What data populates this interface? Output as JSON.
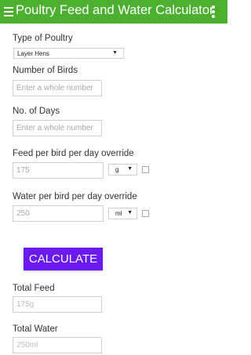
{
  "appbar": {
    "title": "Poultry Feed and Water Calculator"
  },
  "form": {
    "poultry_type": {
      "label": "Type of Poultry",
      "value": "Layer Hens"
    },
    "birds": {
      "label": "Number of Birds",
      "placeholder": "Enter a whole number"
    },
    "days": {
      "label": "No. of Days",
      "placeholder": "Enter a whole number"
    },
    "feed_override": {
      "label": "Feed per bird per day override",
      "value": "175",
      "unit": "g"
    },
    "water_override": {
      "label": "Water per bird per day override",
      "value": "250",
      "unit": "ml"
    },
    "calculate_label": "CALCULATE"
  },
  "results": {
    "total_feed": {
      "label": "Total Feed",
      "value": "175g"
    },
    "total_water": {
      "label": "Total Water",
      "value": "250ml"
    }
  },
  "colors": {
    "appbar": "#4caf2f",
    "button": "#6a1aee"
  }
}
